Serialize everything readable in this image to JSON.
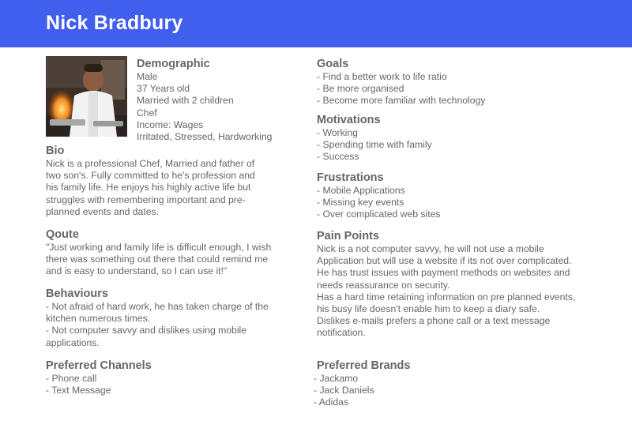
{
  "header": {
    "name": "Nick Bradbury"
  },
  "colors": {
    "header_bg": "#3f5fec",
    "text": "#666666"
  },
  "photo": {
    "subject": "chef-cooking-photo"
  },
  "demographic": {
    "title": "Demographic",
    "lines": [
      "Male",
      "37 Years old",
      "Married with 2 children",
      "Chef",
      "Income: Wages",
      "Irritated, Stressed, Hardworking"
    ]
  },
  "bio": {
    "title": "Bio",
    "lines": [
      "Nick is a professional Chef, Married and father of",
      "two son's. Fully committed to he's profession and",
      "his family life. He enjoys his highly active life but",
      "struggles with remembering important and pre-",
      "planned events and dates."
    ]
  },
  "quote": {
    "title": "Qoute",
    "lines": [
      "\"Just working and family life is difficult enough, I wish",
      "there was something out there that could remind me",
      "and is easy to understand, so I can use it!\""
    ]
  },
  "behaviours": {
    "title": "Behaviours",
    "lines": [
      "- Not afraid of hard work, he has taken charge of the",
      "kitchen numerous times.",
      "- Not computer savvy and dislikes using mobile",
      "applications."
    ]
  },
  "channels": {
    "title": "Preferred Channels",
    "items": [
      "- Phone call",
      "- Text Message"
    ]
  },
  "goals": {
    "title": "Goals",
    "items": [
      "- Find a better work to life ratio",
      "- Be more organised",
      "- Become more familiar with technology"
    ]
  },
  "motivations": {
    "title": "Motivations",
    "items": [
      "- Working",
      "- Spending time with family",
      "- Success"
    ]
  },
  "frustrations": {
    "title": "Frustrations",
    "items": [
      "- Mobile Applications",
      "- Missing key events",
      "- Over complicated web sites"
    ]
  },
  "pain_points": {
    "title": "Pain Points",
    "lines": [
      "Nick is a not computer savvy, he will not use a mobile",
      "Application but will use a website if its not over complicated.",
      "He has trust issues with payment methods on websites and",
      "needs reassurance on security.",
      "Has a hard time retaining information on pre planned events,",
      "his busy life doesn't enable him to keep a diary safe.",
      "Dislikes e-mails prefers a phone call or a text message",
      "notification."
    ]
  },
  "brands": {
    "title": "Preferred Brands",
    "items": [
      "- Jackamo",
      "- Jack Daniels",
      "- Adidas"
    ]
  }
}
